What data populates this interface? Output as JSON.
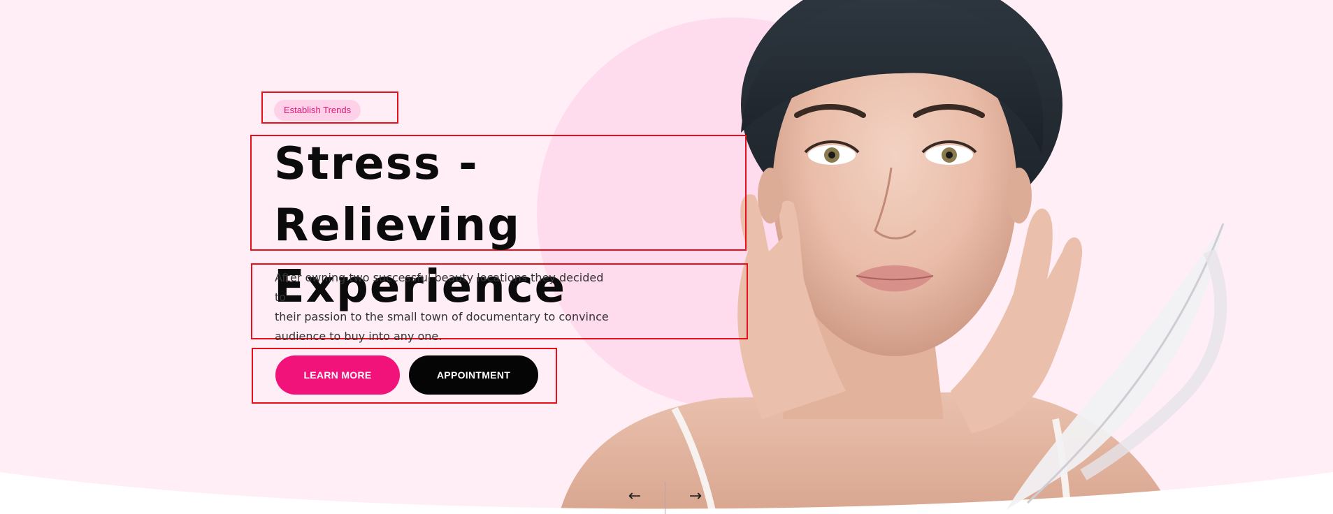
{
  "hero": {
    "badge": "Establish Trends",
    "title_line1": "Stress - Relieving",
    "title_line2": "Experience",
    "description_line1": "After owning two successful beauty locations they decided to",
    "description_line2": "their passion to the small town of documentary to convince",
    "description_line3": "audience to buy into any one.",
    "learn_more_label": "LEARN MORE",
    "appointment_label": "APPOINTMENT"
  },
  "navigation": {
    "prev_arrow": "←",
    "next_arrow": "→"
  },
  "colors": {
    "background": "#ffeef6",
    "circle": "#ffdced",
    "accent_pink": "#f2137a",
    "badge_bg": "#ffd1e8",
    "button_dark": "#050505",
    "highlight_border": "#e8101a"
  },
  "icons": {
    "prev": "arrow-left-icon",
    "next": "arrow-right-icon"
  }
}
